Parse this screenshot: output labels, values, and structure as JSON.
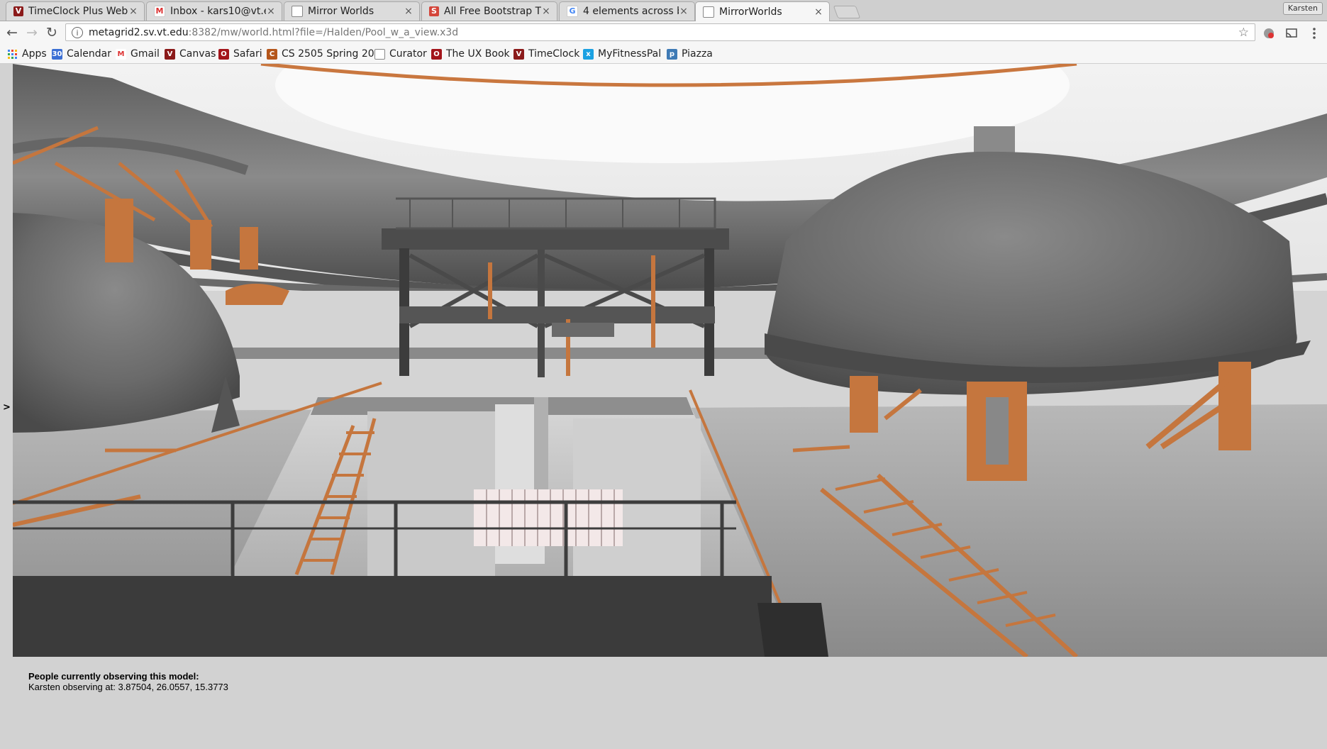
{
  "tabs": [
    {
      "title": "TimeClock Plus Web",
      "favicon": "vt-shield-icon",
      "active": false
    },
    {
      "title": "Inbox - kars10@vt.ed",
      "favicon": "gmail-icon",
      "active": false
    },
    {
      "title": "Mirror Worlds",
      "favicon": "page-icon",
      "active": false
    },
    {
      "title": "All Free Bootstrap Th",
      "favicon": "s-icon",
      "active": false
    },
    {
      "title": "4 elements across bo",
      "favicon": "google-icon",
      "active": false
    },
    {
      "title": "MirrorWorlds",
      "favicon": "page-icon",
      "active": true
    }
  ],
  "profile_name": "Karsten",
  "address": {
    "host": "metagrid2.sv.vt.edu",
    "rest": ":8382/mw/world.html?file=/Halden/Pool_w_a_view.x3d"
  },
  "bookmarks": [
    {
      "label": "Apps",
      "icon": "apps-grid-icon"
    },
    {
      "label": "Calendar",
      "icon": "calendar-icon"
    },
    {
      "label": "Gmail",
      "icon": "gmail-icon"
    },
    {
      "label": "Canvas",
      "icon": "vt-shield-icon"
    },
    {
      "label": "Safari",
      "icon": "safari-icon"
    },
    {
      "label": "CS 2505 Spring 20",
      "icon": "cs-icon"
    },
    {
      "label": "Curator",
      "icon": "page-icon"
    },
    {
      "label": "The UX Book",
      "icon": "book-icon"
    },
    {
      "label": "TimeClock",
      "icon": "vt-shield-icon"
    },
    {
      "label": "MyFitnessPal",
      "icon": "fitness-icon"
    },
    {
      "label": "Piazza",
      "icon": "piazza-icon"
    }
  ],
  "page": {
    "side_toggle": ">",
    "observers_heading": "People currently observing this model:",
    "observer_line": "Karsten observing at: 3.87504, 26.0557, 15.3773"
  },
  "colors": {
    "rust": "#c5763e",
    "steel": "#5a5a5a",
    "floor": "#9b9b9b",
    "wall": "#cfcfcf"
  }
}
